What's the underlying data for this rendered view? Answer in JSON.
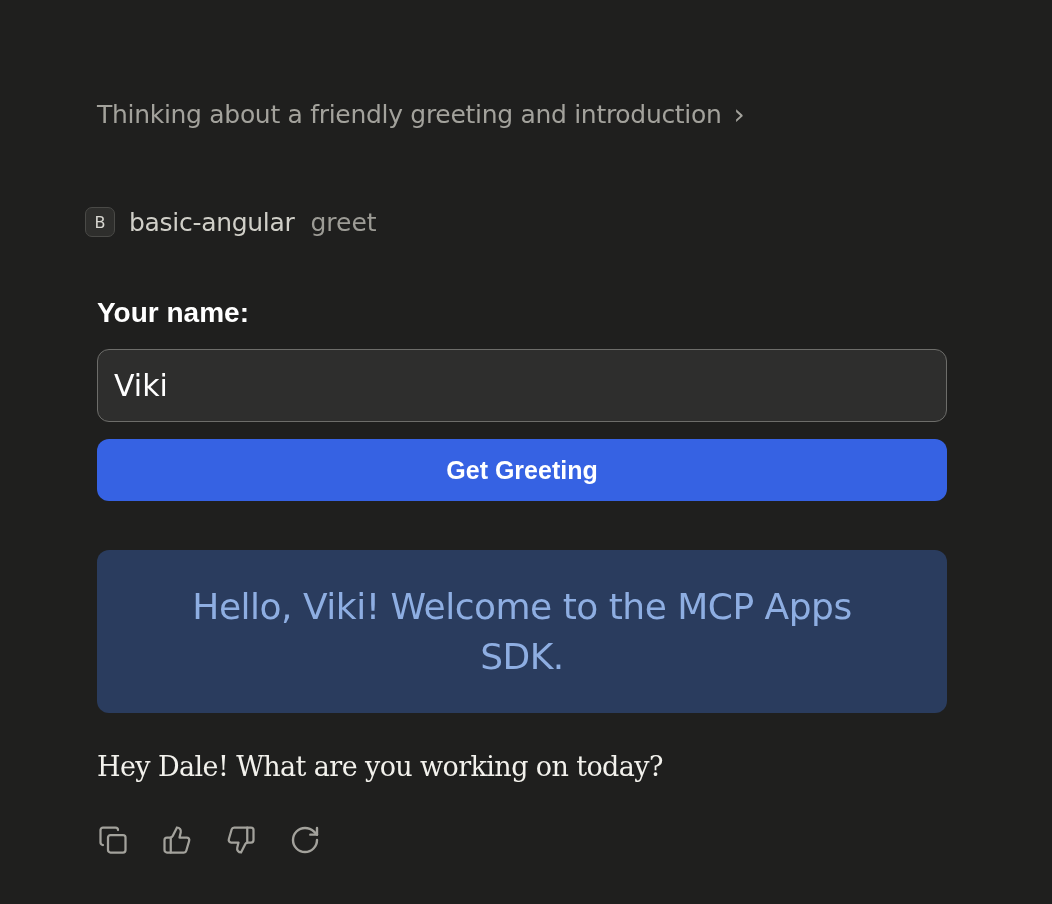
{
  "thinking": {
    "text": "Thinking about a friendly greeting and introduction",
    "chevron": "›"
  },
  "tool": {
    "badge": "B",
    "server": "basic-angular",
    "name": "greet"
  },
  "form": {
    "label": "Your name:",
    "input": {
      "value": "Viki"
    },
    "button": "Get Greeting"
  },
  "greeting": "Hello, Viki! Welcome to the MCP Apps SDK.",
  "reply": "Hey Dale! What are you working on today?",
  "actions": [
    {
      "kind": "copy"
    },
    {
      "kind": "thumbs-up"
    },
    {
      "kind": "thumbs-down"
    },
    {
      "kind": "retry"
    }
  ]
}
